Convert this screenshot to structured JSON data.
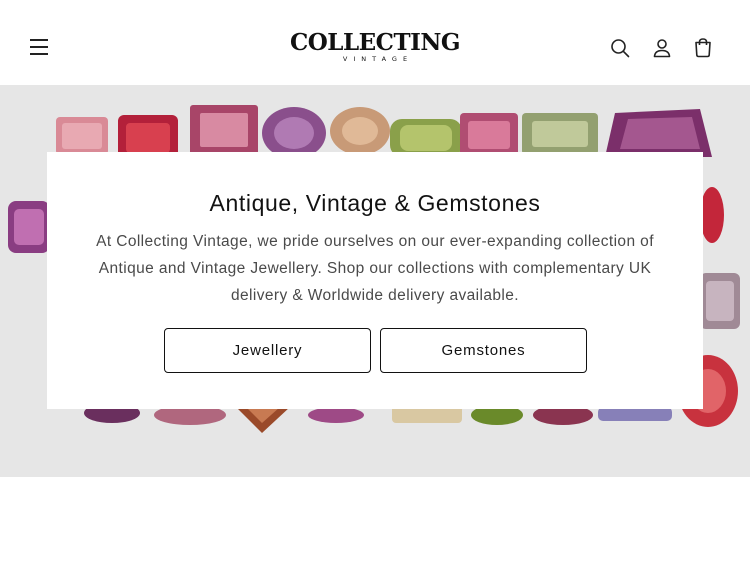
{
  "header": {
    "logo_main": "COLLECTING",
    "logo_sub": "VINTAGE",
    "icons": [
      "menu-icon",
      "search-icon",
      "account-icon",
      "cart-icon"
    ]
  },
  "hero": {
    "title": "Antique, Vintage & Gemstones",
    "text": "At Collecting Vintage, we pride ourselves on our ever-expanding collection of Antique and Vintage Jewellery. Shop our collections with complementary UK delivery & Worldwide delivery available.",
    "buttons": {
      "jewellery": "Jewellery",
      "gemstones": "Gemstones"
    },
    "background_color": "#e6e6e6"
  }
}
